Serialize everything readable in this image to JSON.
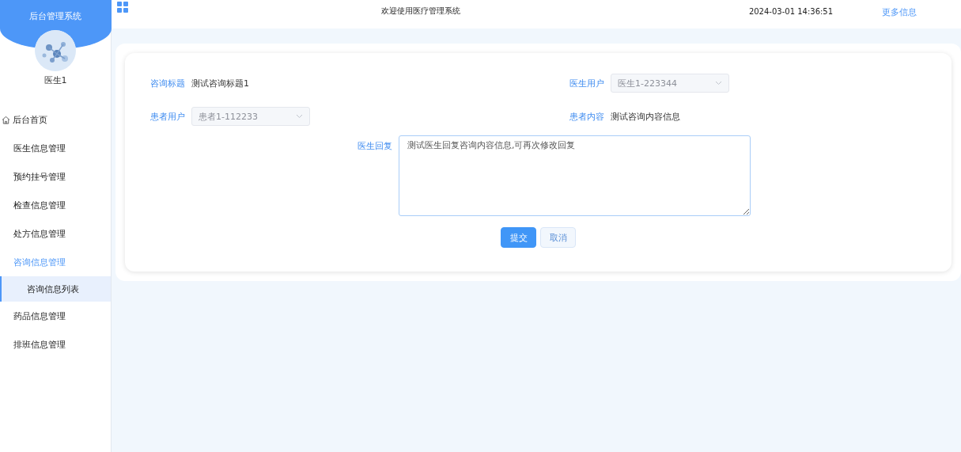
{
  "sidebar": {
    "title": "后台管理系统",
    "user": "医生1",
    "items": [
      {
        "label": "后台首页",
        "kind": "home",
        "expanded": false
      },
      {
        "label": "医生信息管理",
        "kind": "group",
        "expanded": false
      },
      {
        "label": "预约挂号管理",
        "kind": "group",
        "expanded": false
      },
      {
        "label": "检查信息管理",
        "kind": "group",
        "expanded": false
      },
      {
        "label": "处方信息管理",
        "kind": "group",
        "expanded": false
      },
      {
        "label": "咨询信息管理",
        "kind": "group",
        "expanded": true,
        "children": [
          {
            "label": "咨询信息列表",
            "selected": true
          }
        ]
      },
      {
        "label": "药品信息管理",
        "kind": "group",
        "expanded": false
      },
      {
        "label": "排班信息管理",
        "kind": "group",
        "expanded": false
      }
    ]
  },
  "header": {
    "title": "欢迎使用医疗管理系统",
    "datetime": "2024-03-01 14:36:51",
    "link": "更多信息"
  },
  "form": {
    "fields": [
      {
        "label": "咨询标题",
        "kind": "text",
        "value": "测试咨询标题1"
      },
      {
        "label": "医生用户",
        "kind": "select",
        "value": "医生1-223344",
        "disabled": true
      },
      {
        "label": "患者用户",
        "kind": "select",
        "value": "患者1-112233",
        "disabled": true
      },
      {
        "label": "患者内容",
        "kind": "text",
        "value": "测试咨询内容信息"
      }
    ],
    "reply": {
      "label": "医生回复",
      "value": "测试医生回复咨询内容信息,可再次修改回复"
    },
    "buttons": [
      {
        "label": "提交",
        "kind": "primary"
      },
      {
        "label": "取消",
        "kind": "plain"
      }
    ]
  }
}
